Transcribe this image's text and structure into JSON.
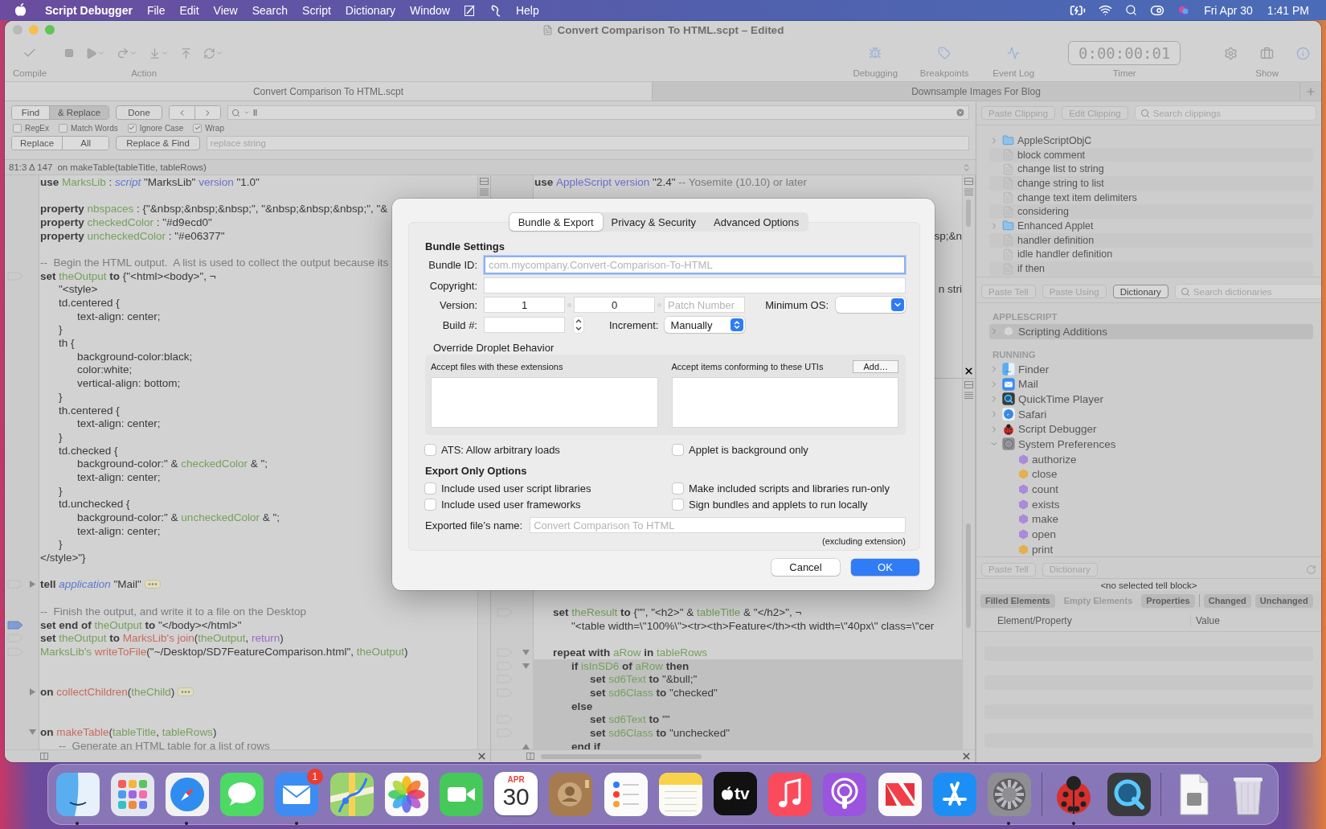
{
  "menubar": {
    "app_name": "Script Debugger",
    "menus": [
      "File",
      "Edit",
      "View",
      "Search",
      "Script",
      "Dictionary",
      "Window"
    ],
    "trailing_menus": [
      "Help"
    ],
    "date": "Fri Apr 30",
    "time": "1:41 PM"
  },
  "window": {
    "title": "Convert Comparison To HTML.scpt – Edited",
    "toolbar": {
      "compile_label": "Compile",
      "action_label": "Action",
      "right_items": [
        {
          "kind": "bug",
          "label": "Debugging"
        },
        {
          "kind": "tag",
          "label": "Breakpoints"
        },
        {
          "kind": "waveform",
          "label": "Event Log"
        }
      ],
      "timer": {
        "value": "0:00:00:01",
        "label": "Timer"
      },
      "show_label": "Show"
    },
    "tabs": [
      {
        "label": "Convert Comparison To HTML.scpt",
        "selected": true
      },
      {
        "label": "Downsample Images For Blog",
        "selected": false
      }
    ],
    "find_bar": {
      "modes": [
        {
          "label": "Find",
          "selected": false
        },
        {
          "label": "& Replace",
          "selected": true
        }
      ],
      "done": "Done",
      "search_value": "ll",
      "options": [
        {
          "label": "RegEx",
          "checked": false
        },
        {
          "label": "Match Words",
          "checked": false
        },
        {
          "label": "Ignore Case",
          "checked": true
        },
        {
          "label": "Wrap",
          "checked": true
        }
      ],
      "replace_buttons": [
        "Replace",
        "All",
        "Replace & Find"
      ],
      "replace_placeholder": "replace string"
    },
    "status": {
      "position": "81:3 Δ 147",
      "handler": "on makeTable(tableTitle, tableRows)"
    },
    "editors": {
      "left": [
        {
          "kind": "code",
          "tokens": [
            {
              "kind": "keyword",
              "text": "use "
            },
            {
              "kind": "variable",
              "text": "MarksLib"
            },
            {
              "kind": "plain",
              "text": " : "
            },
            {
              "kind": "class",
              "text": "script"
            },
            {
              "kind": "plain",
              "text": " \"MarksLib\" "
            },
            {
              "kind": "property",
              "text": "version"
            },
            {
              "kind": "plain",
              "text": " \"1.0\""
            }
          ]
        },
        {
          "kind": "blank"
        },
        {
          "kind": "code",
          "tokens": [
            {
              "kind": "keyword",
              "text": "property "
            },
            {
              "kind": "variable",
              "text": "nbspaces"
            },
            {
              "kind": "plain",
              "text": " : {\"&nbsp;&nbsp;&nbsp;\", \"&nbsp;&nbsp;&nbsp;\", \"&"
            }
          ]
        },
        {
          "kind": "code",
          "tokens": [
            {
              "kind": "keyword",
              "text": "property "
            },
            {
              "kind": "variable",
              "text": "checkedColor"
            },
            {
              "kind": "plain",
              "text": " : \"#d9ecd0\""
            }
          ]
        },
        {
          "kind": "code",
          "tokens": [
            {
              "kind": "keyword",
              "text": "property "
            },
            {
              "kind": "variable",
              "text": "uncheckedColor"
            },
            {
              "kind": "plain",
              "text": " : \"#e06377\""
            }
          ]
        },
        {
          "kind": "blank"
        },
        {
          "kind": "code",
          "tokens": [
            {
              "kind": "comment",
              "text": "--  Begin the HTML output.  A list is used to collect the output because its"
            }
          ]
        },
        {
          "kind": "code",
          "breakpoint": false,
          "tokens": [
            {
              "kind": "keyword",
              "text": "set "
            },
            {
              "kind": "variable",
              "text": "theOutput"
            },
            {
              "kind": "keyword",
              "text": " to"
            },
            {
              "kind": "plain",
              "text": " {\"<html><body>\", ¬"
            }
          ]
        },
        {
          "kind": "code",
          "tokens": [
            {
              "kind": "plain",
              "text": "\t\"<style>"
            }
          ]
        },
        {
          "kind": "code",
          "tokens": [
            {
              "kind": "plain",
              "text": "\ttd.centered {"
            }
          ]
        },
        {
          "kind": "code",
          "tokens": [
            {
              "kind": "plain",
              "text": "\t\ttext-align: center;"
            }
          ]
        },
        {
          "kind": "code",
          "tokens": [
            {
              "kind": "plain",
              "text": "\t}"
            }
          ]
        },
        {
          "kind": "code",
          "tokens": [
            {
              "kind": "plain",
              "text": "\tth {"
            }
          ]
        },
        {
          "kind": "code",
          "tokens": [
            {
              "kind": "plain",
              "text": "\t\tbackground-color:black;"
            }
          ]
        },
        {
          "kind": "code",
          "tokens": [
            {
              "kind": "plain",
              "text": "\t\tcolor:white;"
            }
          ]
        },
        {
          "kind": "code",
          "tokens": [
            {
              "kind": "plain",
              "text": "\t\tvertical-align: bottom;"
            }
          ]
        },
        {
          "kind": "code",
          "tokens": [
            {
              "kind": "plain",
              "text": "\t}"
            }
          ]
        },
        {
          "kind": "code",
          "tokens": [
            {
              "kind": "plain",
              "text": "\tth.centered {"
            }
          ]
        },
        {
          "kind": "code",
          "tokens": [
            {
              "kind": "plain",
              "text": "\t\ttext-align: center;"
            }
          ]
        },
        {
          "kind": "code",
          "tokens": [
            {
              "kind": "plain",
              "text": "\t}"
            }
          ]
        },
        {
          "kind": "code",
          "tokens": [
            {
              "kind": "plain",
              "text": "\ttd.checked {"
            }
          ]
        },
        {
          "kind": "code",
          "tokens": [
            {
              "kind": "plain",
              "text": "\t\tbackground-color:\" & "
            },
            {
              "kind": "variable",
              "text": "checkedColor"
            },
            {
              "kind": "plain",
              "text": " & \";"
            }
          ]
        },
        {
          "kind": "code",
          "tokens": [
            {
              "kind": "plain",
              "text": "\t\ttext-align: center;"
            }
          ]
        },
        {
          "kind": "code",
          "tokens": [
            {
              "kind": "plain",
              "text": "\t}"
            }
          ]
        },
        {
          "kind": "code",
          "tokens": [
            {
              "kind": "plain",
              "text": "\ttd.unchecked {"
            }
          ]
        },
        {
          "kind": "code",
          "tokens": [
            {
              "kind": "plain",
              "text": "\t\tbackground-color:\" & "
            },
            {
              "kind": "variable",
              "text": "uncheckedColor"
            },
            {
              "kind": "plain",
              "text": " & \";"
            }
          ]
        },
        {
          "kind": "code",
          "tokens": [
            {
              "kind": "plain",
              "text": "\t\ttext-align: center;"
            }
          ]
        },
        {
          "kind": "code",
          "tokens": [
            {
              "kind": "plain",
              "text": "\t}"
            }
          ]
        },
        {
          "kind": "code",
          "tokens": [
            {
              "kind": "plain",
              "text": "</style>\"}"
            }
          ]
        },
        {
          "kind": "blank"
        },
        {
          "kind": "code",
          "breakpoint": false,
          "expanded": false,
          "tokens": [
            {
              "kind": "keyword",
              "text": "tell "
            },
            {
              "kind": "class",
              "text": "application"
            },
            {
              "kind": "plain",
              "text": " \"Mail\""
            }
          ]
        },
        {
          "kind": "blank"
        },
        {
          "kind": "code",
          "tokens": [
            {
              "kind": "comment",
              "text": "--  Finish the output, and write it to a file on the Desktop"
            }
          ]
        },
        {
          "kind": "code",
          "breakpoint": true,
          "tokens": [
            {
              "kind": "keyword",
              "text": "set end of "
            },
            {
              "kind": "variable",
              "text": "theOutput"
            },
            {
              "kind": "keyword",
              "text": " to"
            },
            {
              "kind": "plain",
              "text": " \"</body></html>\""
            }
          ]
        },
        {
          "kind": "code",
          "breakpoint": false,
          "tokens": [
            {
              "kind": "keyword",
              "text": "set "
            },
            {
              "kind": "variable",
              "text": "theOutput"
            },
            {
              "kind": "keyword",
              "text": " to "
            },
            {
              "kind": "handler",
              "text": "MarksLib's join"
            },
            {
              "kind": "plain",
              "text": "("
            },
            {
              "kind": "variable",
              "text": "theOutput"
            },
            {
              "kind": "plain",
              "text": ", "
            },
            {
              "kind": "constant",
              "text": "return"
            },
            {
              "kind": "plain",
              "text": ")"
            }
          ]
        },
        {
          "kind": "code",
          "breakpoint": false,
          "tokens": [
            {
              "kind": "variable",
              "text": "MarksLib's "
            },
            {
              "kind": "handler",
              "text": "writeToFile"
            },
            {
              "kind": "plain",
              "text": "(\"~/Desktop/SD7FeatureComparison.html\", "
            },
            {
              "kind": "variable",
              "text": "theOutput"
            },
            {
              "kind": "plain",
              "text": ")"
            }
          ]
        },
        {
          "kind": "blank"
        },
        {
          "kind": "blank"
        },
        {
          "kind": "code",
          "expanded": false,
          "tokens": [
            {
              "kind": "keyword",
              "text": "on "
            },
            {
              "kind": "handler",
              "text": "collectChildren"
            },
            {
              "kind": "plain",
              "text": "("
            },
            {
              "kind": "variable",
              "text": "theChild"
            },
            {
              "kind": "plain",
              "text": ")"
            }
          ]
        },
        {
          "kind": "blank"
        },
        {
          "kind": "blank"
        },
        {
          "kind": "code",
          "expanded": true,
          "tokens": [
            {
              "kind": "keyword",
              "text": "on "
            },
            {
              "kind": "handler",
              "text": "makeTable"
            },
            {
              "kind": "plain",
              "text": "("
            },
            {
              "kind": "variable",
              "text": "tableTitle"
            },
            {
              "kind": "plain",
              "text": ", "
            },
            {
              "kind": "variable",
              "text": "tableRows"
            },
            {
              "kind": "plain",
              "text": ")"
            }
          ]
        },
        {
          "kind": "code",
          "tokens": [
            {
              "kind": "comment",
              "text": "\t--  Generate an HTML table for a list of rows"
            }
          ]
        }
      ],
      "right_top": [
        {
          "kind": "code",
          "tokens": [
            {
              "kind": "keyword",
              "text": "use "
            },
            {
              "kind": "property",
              "text": "AppleScript version"
            },
            {
              "kind": "plain",
              "text": " \"2.4\" "
            },
            {
              "kind": "comment",
              "text": "-- Yosemite (10.10) or later"
            }
          ]
        },
        {
          "kind": "blank"
        },
        {
          "kind": "blank"
        },
        {
          "kind": "blank"
        },
        {
          "kind": "clipped",
          "tokens": [
            {
              "kind": "plain",
              "text": "sp;&n"
            }
          ]
        },
        {
          "kind": "blank"
        },
        {
          "kind": "blank"
        },
        {
          "kind": "blank"
        },
        {
          "kind": "clipped",
          "tokens": [
            {
              "kind": "plain",
              "text": "n stri"
            }
          ]
        }
      ],
      "right_bottom": [
        {
          "kind": "code",
          "highlighted": false,
          "breakpoint": false,
          "tokens": [
            {
              "kind": "keyword",
              "text": "\tset "
            },
            {
              "kind": "variable",
              "text": "theResult"
            },
            {
              "kind": "keyword",
              "text": " to"
            },
            {
              "kind": "plain",
              "text": " {\"\", \"<h2>\" & "
            },
            {
              "kind": "variable",
              "text": "tableTitle"
            },
            {
              "kind": "plain",
              "text": " & \"</h2>\", ¬"
            }
          ]
        },
        {
          "kind": "code",
          "highlighted": false,
          "tokens": [
            {
              "kind": "plain",
              "text": "\t\t\"<table width=\\\"100%\\\"><tr><th>Feature</th><th width=\\\"40px\\\" class=\\\"cer"
            }
          ]
        },
        {
          "kind": "blank"
        },
        {
          "kind": "code",
          "highlighted": false,
          "breakpoint": false,
          "expanded": true,
          "tokens": [
            {
              "kind": "keyword",
              "text": "\trepeat with "
            },
            {
              "kind": "variable",
              "text": "aRow"
            },
            {
              "kind": "keyword",
              "text": " in "
            },
            {
              "kind": "variable",
              "text": "tableRows"
            }
          ]
        },
        {
          "kind": "code",
          "highlighted": true,
          "breakpoint": false,
          "expanded": true,
          "tokens": [
            {
              "kind": "keyword",
              "text": "\t\tif "
            },
            {
              "kind": "variable",
              "text": "isInSD6"
            },
            {
              "kind": "keyword",
              "text": " of "
            },
            {
              "kind": "variable",
              "text": "aRow"
            },
            {
              "kind": "keyword",
              "text": " then"
            }
          ]
        },
        {
          "kind": "code",
          "highlighted": true,
          "breakpoint": false,
          "tokens": [
            {
              "kind": "keyword",
              "text": "\t\t\tset "
            },
            {
              "kind": "variable",
              "text": "sd6Text"
            },
            {
              "kind": "keyword",
              "text": " to"
            },
            {
              "kind": "plain",
              "text": " \"&bull;\""
            }
          ]
        },
        {
          "kind": "code",
          "highlighted": true,
          "breakpoint": false,
          "tokens": [
            {
              "kind": "keyword",
              "text": "\t\t\tset "
            },
            {
              "kind": "variable",
              "text": "sd6Class"
            },
            {
              "kind": "keyword",
              "text": " to"
            },
            {
              "kind": "plain",
              "text": " \"checked\""
            }
          ]
        },
        {
          "kind": "code",
          "highlighted": true,
          "tokens": [
            {
              "kind": "keyword",
              "text": "\t\telse"
            }
          ]
        },
        {
          "kind": "code",
          "highlighted": true,
          "breakpoint": false,
          "tokens": [
            {
              "kind": "keyword",
              "text": "\t\t\tset "
            },
            {
              "kind": "variable",
              "text": "sd6Text"
            },
            {
              "kind": "keyword",
              "text": " to"
            },
            {
              "kind": "plain",
              "text": " \"\""
            }
          ]
        },
        {
          "kind": "code",
          "highlighted": true,
          "breakpoint": false,
          "tokens": [
            {
              "kind": "keyword",
              "text": "\t\t\tset "
            },
            {
              "kind": "variable",
              "text": "sd6Class"
            },
            {
              "kind": "keyword",
              "text": " to"
            },
            {
              "kind": "plain",
              "text": " \"unchecked\""
            }
          ]
        },
        {
          "kind": "code",
          "highlighted": true,
          "block_end": true,
          "tokens": [
            {
              "kind": "keyword",
              "text": "\t\tend if"
            }
          ]
        }
      ]
    },
    "sidebar": {
      "clippings": {
        "buttons": [
          {
            "label": "Paste Clipping",
            "disabled": true
          },
          {
            "label": "Edit Clipping",
            "disabled": true
          }
        ],
        "search_placeholder": "Search clippings",
        "items": [
          {
            "kind": "folder",
            "label": "AppleScriptObjC",
            "expanded": false
          },
          {
            "kind": "file",
            "label": "block comment"
          },
          {
            "kind": "file",
            "label": "change list to string"
          },
          {
            "kind": "file",
            "label": "change string to list"
          },
          {
            "kind": "file",
            "label": "change text item delimiters"
          },
          {
            "kind": "file",
            "label": "considering"
          },
          {
            "kind": "folder",
            "label": "Enhanced Applet",
            "expanded": false
          },
          {
            "kind": "file",
            "label": "handler definition"
          },
          {
            "kind": "file",
            "label": "idle handler definition"
          },
          {
            "kind": "file",
            "label": "if then"
          }
        ]
      },
      "dictionary": {
        "buttons": [
          {
            "label": "Paste Tell",
            "disabled": true
          },
          {
            "label": "Paste Using",
            "disabled": true
          },
          {
            "label": "Dictionary",
            "disabled": false
          }
        ],
        "search_placeholder": "Search dictionaries",
        "sections": [
          {
            "header": "APPLESCRIPT",
            "items": [
              {
                "kind": "addition",
                "label": "Scripting Additions",
                "selected": true,
                "expanded": false
              }
            ]
          },
          {
            "header": "RUNNING",
            "items": [
              {
                "kind": "finder",
                "label": "Finder",
                "selected": false,
                "expanded": false
              },
              {
                "kind": "mail",
                "label": "Mail",
                "selected": false,
                "expanded": false
              },
              {
                "kind": "quicktime",
                "label": "QuickTime Player",
                "selected": false,
                "expanded": false
              },
              {
                "kind": "safari",
                "label": "Safari",
                "selected": false,
                "expanded": false
              },
              {
                "kind": "scriptdebugger",
                "label": "Script Debugger",
                "selected": false,
                "expanded": false
              },
              {
                "kind": "sysprefs",
                "label": "System Preferences",
                "selected": false,
                "expanded": true,
                "children": [
                  {
                    "label": "authorize",
                    "color": "#a98bd8"
                  },
                  {
                    "label": "close",
                    "color": "#e2b04e"
                  },
                  {
                    "label": "count",
                    "color": "#a98bd8"
                  },
                  {
                    "label": "exists",
                    "color": "#a98bd8"
                  },
                  {
                    "label": "make",
                    "color": "#a98bd8"
                  },
                  {
                    "label": "open",
                    "color": "#a98bd8"
                  },
                  {
                    "label": "print",
                    "color": "#e2b04e"
                  }
                ]
              }
            ]
          }
        ]
      },
      "inspector": {
        "buttons": [
          {
            "label": "Paste Tell",
            "disabled": true
          },
          {
            "label": "Dictionary",
            "disabled": true
          }
        ],
        "message": "<no selected tell block>",
        "filters": [
          {
            "label": "Filled Elements",
            "selected": true
          },
          {
            "label": "Empty Elements",
            "selected": false
          },
          {
            "label": "Properties",
            "selected": true
          },
          {
            "label": "Changed",
            "selected": true
          },
          {
            "label": "Unchanged",
            "selected": true
          }
        ],
        "columns": [
          "Element/Property",
          "Value"
        ]
      }
    }
  },
  "dialog": {
    "tabs": [
      {
        "label": "Bundle & Export",
        "selected": true
      },
      {
        "label": "Privacy & Security",
        "selected": false
      },
      {
        "label": "Advanced Options",
        "selected": false
      }
    ],
    "bundle_settings": {
      "heading": "Bundle Settings",
      "bundle_id": {
        "label": "Bundle ID:",
        "placeholder": "com.mycompany.Convert-Comparison-To-HTML",
        "focused": true
      },
      "copyright": {
        "label": "Copyright:"
      },
      "version": {
        "label": "Version:",
        "major": "1",
        "minor": "0",
        "patch_placeholder": "Patch Number"
      },
      "minimum_os": {
        "label": "Minimum OS:"
      },
      "build": {
        "label": "Build #:"
      },
      "increment": {
        "label": "Increment:",
        "value": "Manually"
      }
    },
    "droplet": {
      "heading": "Override Droplet Behavior",
      "extensions_label": "Accept files with these extensions",
      "utis_label": "Accept items conforming to these UTIs",
      "add_button": "Add…"
    },
    "options": [
      {
        "label": "ATS: Allow arbitrary loads",
        "checked": false
      },
      {
        "label": "Applet is background only",
        "checked": false
      }
    ],
    "export": {
      "heading": "Export Only Options",
      "options": [
        {
          "label": "Include used user script libraries",
          "checked": false
        },
        {
          "label": "Make included scripts and libraries run-only",
          "checked": false
        },
        {
          "label": "Include used user frameworks",
          "checked": false
        },
        {
          "label": "Sign bundles and applets to run locally",
          "checked": false
        }
      ],
      "file_name": {
        "label": "Exported file’s name:",
        "placeholder": "Convert Comparison To HTML"
      },
      "note": "(excluding extension)"
    },
    "buttons": [
      {
        "label": "Cancel",
        "default": false
      },
      {
        "label": "OK",
        "default": true
      }
    ]
  },
  "dock": {
    "items": [
      {
        "kind": "finder",
        "running": true
      },
      {
        "kind": "launchpad",
        "running": false
      },
      {
        "kind": "safari",
        "running": true
      },
      {
        "kind": "messages",
        "running": false
      },
      {
        "kind": "mail",
        "running": true,
        "badge": "1"
      },
      {
        "kind": "maps",
        "running": false
      },
      {
        "kind": "photos",
        "running": false
      },
      {
        "kind": "facetime",
        "running": false
      },
      {
        "kind": "calendar",
        "running": false,
        "month": "APR",
        "day": "30"
      },
      {
        "kind": "contacts",
        "running": false
      },
      {
        "kind": "reminders",
        "running": false
      },
      {
        "kind": "notes",
        "running": false
      },
      {
        "kind": "tv",
        "running": false,
        "label": "tv"
      },
      {
        "kind": "music",
        "running": false
      },
      {
        "kind": "podcasts",
        "running": false
      },
      {
        "kind": "news",
        "running": false
      },
      {
        "kind": "appstore",
        "running": false
      },
      {
        "kind": "sysprefs",
        "running": true
      },
      {
        "kind": "separator"
      },
      {
        "kind": "scriptdebugger",
        "running": true
      },
      {
        "kind": "quicktime",
        "running": false
      },
      {
        "kind": "separator"
      },
      {
        "kind": "document",
        "running": false
      },
      {
        "kind": "trash",
        "running": false
      }
    ]
  }
}
